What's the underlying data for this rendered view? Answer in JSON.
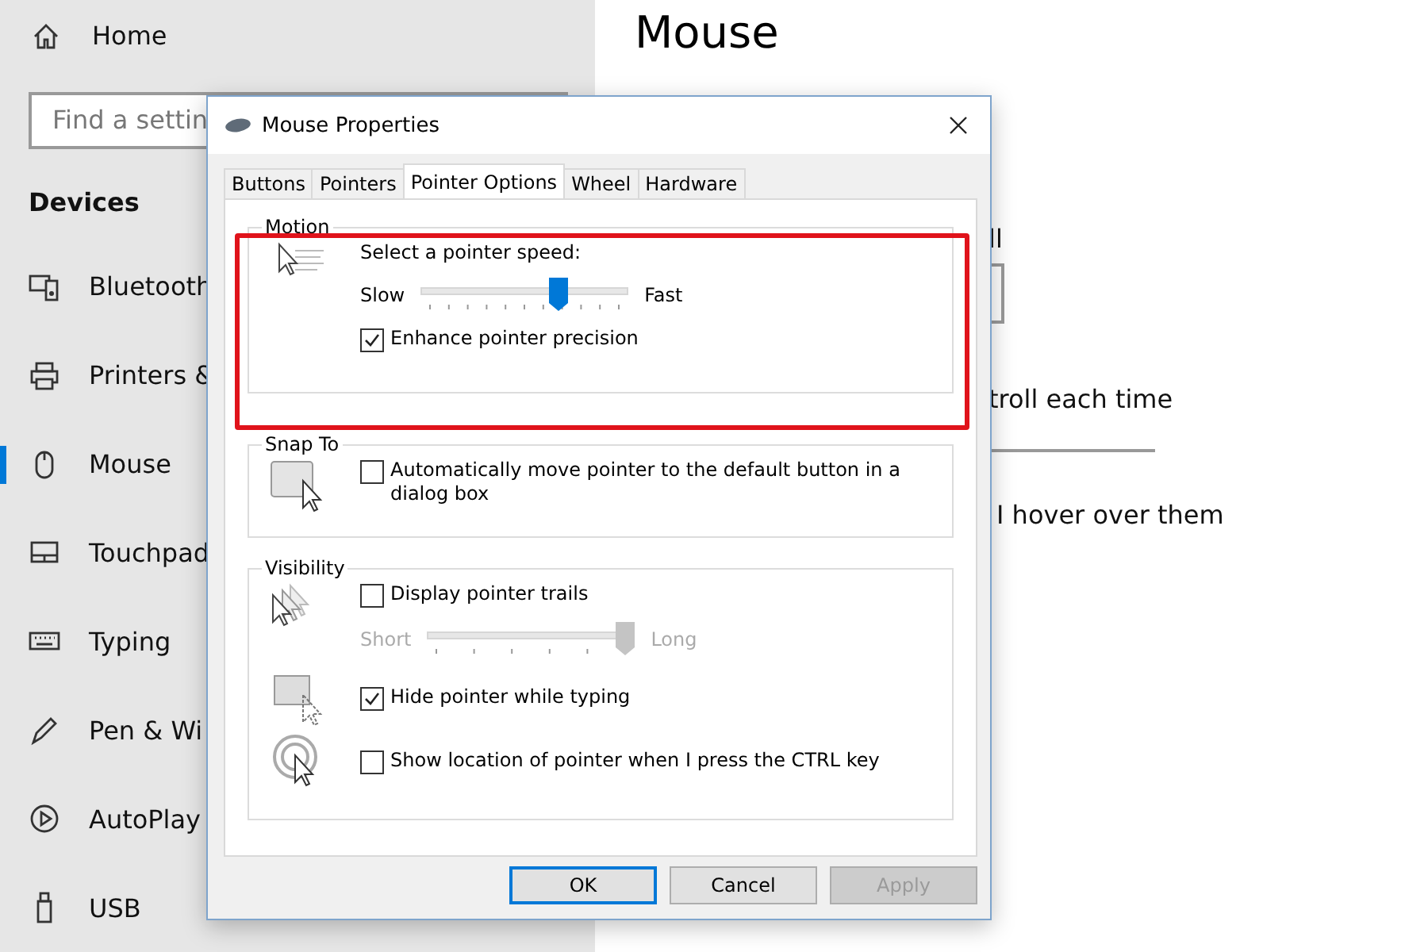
{
  "sidebar": {
    "home": "Home",
    "search": {
      "placeholder": "Find a settin"
    },
    "section": "Devices",
    "items": [
      {
        "label": "Bluetooth",
        "selected": false
      },
      {
        "label": "Printers &",
        "selected": false
      },
      {
        "label": "Mouse",
        "selected": true
      },
      {
        "label": "Touchpad",
        "selected": false
      },
      {
        "label": "Typing",
        "selected": false
      },
      {
        "label": "Pen & Wi",
        "selected": false
      },
      {
        "label": "AutoPlay",
        "selected": false
      },
      {
        "label": "USB",
        "selected": false
      }
    ]
  },
  "page": {
    "title": "Mouse",
    "fragments": [
      "ll",
      "troll each time",
      "I hover over them"
    ]
  },
  "dialog": {
    "title": "Mouse Properties",
    "tabs": [
      {
        "label": "Buttons",
        "selected": false
      },
      {
        "label": "Pointers",
        "selected": false
      },
      {
        "label": "Pointer Options",
        "selected": true
      },
      {
        "label": "Wheel",
        "selected": false
      },
      {
        "label": "Hardware",
        "selected": false
      }
    ],
    "motion": {
      "legend": "Motion",
      "prompt": "Select a pointer speed:",
      "slider": {
        "min_label": "Slow",
        "max_label": "Fast",
        "level": 0.68,
        "disabled": false
      },
      "precision": {
        "label": "Enhance pointer precision",
        "checked": true
      },
      "highlighted": true
    },
    "snap_to": {
      "legend": "Snap To",
      "option": {
        "label": "Automatically move pointer to the default button in a dialog box",
        "checked": false
      }
    },
    "visibility": {
      "legend": "Visibility",
      "trails": {
        "label": "Display pointer trails",
        "checked": false
      },
      "trail_slider": {
        "min_label": "Short",
        "max_label": "Long",
        "level": 1,
        "disabled": true
      },
      "hide": {
        "label": "Hide pointer while typing",
        "checked": true
      },
      "show_location": {
        "label": "Show location of pointer when I press the CTRL key",
        "checked": false
      }
    },
    "buttons": [
      {
        "label": "OK",
        "default": true,
        "disabled": false
      },
      {
        "label": "Cancel",
        "default": false,
        "disabled": false
      },
      {
        "label": "Apply",
        "default": false,
        "disabled": true
      }
    ]
  }
}
